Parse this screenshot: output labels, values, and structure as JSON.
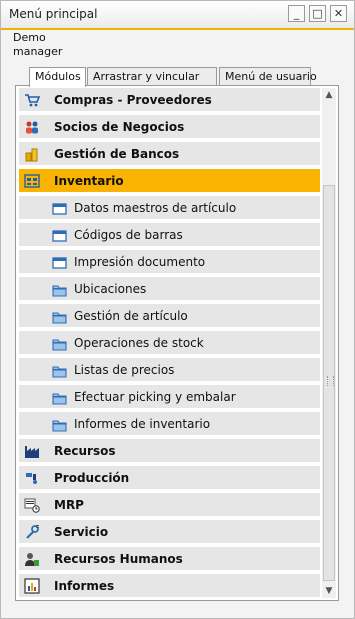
{
  "window": {
    "title": "Menú principal",
    "minimize": "_",
    "maximize": "□",
    "close": "✕"
  },
  "user": {
    "line1": "Demo",
    "line2": "manager"
  },
  "tabs": [
    {
      "label": "Módulos",
      "active": true
    },
    {
      "label": "Arrastrar y vincular",
      "active": false
    },
    {
      "label": "Menú de usuario",
      "active": false
    }
  ],
  "menu": [
    {
      "label": "Compras - Proveedores",
      "icon": "cart-icon",
      "level": "top"
    },
    {
      "label": "Socios de Negocios",
      "icon": "people-icon",
      "level": "top"
    },
    {
      "label": "Gestión de Bancos",
      "icon": "coins-icon",
      "level": "top"
    },
    {
      "label": "Inventario",
      "icon": "inventory-icon",
      "level": "top",
      "selected": true
    },
    {
      "label": "Datos maestros de artículo",
      "icon": "form-icon",
      "level": "sub"
    },
    {
      "label": "Códigos de barras",
      "icon": "form-icon",
      "level": "sub"
    },
    {
      "label": "Impresión documento",
      "icon": "form-icon",
      "level": "sub"
    },
    {
      "label": "Ubicaciones",
      "icon": "folder-icon",
      "level": "sub"
    },
    {
      "label": "Gestión de artículo",
      "icon": "folder-icon",
      "level": "sub"
    },
    {
      "label": "Operaciones de stock",
      "icon": "folder-icon",
      "level": "sub"
    },
    {
      "label": "Listas de precios",
      "icon": "folder-icon",
      "level": "sub"
    },
    {
      "label": "Efectuar picking y embalar",
      "icon": "folder-icon",
      "level": "sub"
    },
    {
      "label": "Informes de inventario",
      "icon": "folder-icon",
      "level": "sub"
    },
    {
      "label": "Recursos",
      "icon": "factory-icon",
      "level": "top"
    },
    {
      "label": "Producción",
      "icon": "production-icon",
      "level": "top"
    },
    {
      "label": "MRP",
      "icon": "mrp-icon",
      "level": "top"
    },
    {
      "label": "Servicio",
      "icon": "wrench-icon",
      "level": "top"
    },
    {
      "label": "Recursos Humanos",
      "icon": "hr-icon",
      "level": "top"
    },
    {
      "label": "Informes",
      "icon": "report-icon",
      "level": "top"
    }
  ],
  "colors": {
    "accent": "#f9b300",
    "row": "#e6e6e6"
  }
}
